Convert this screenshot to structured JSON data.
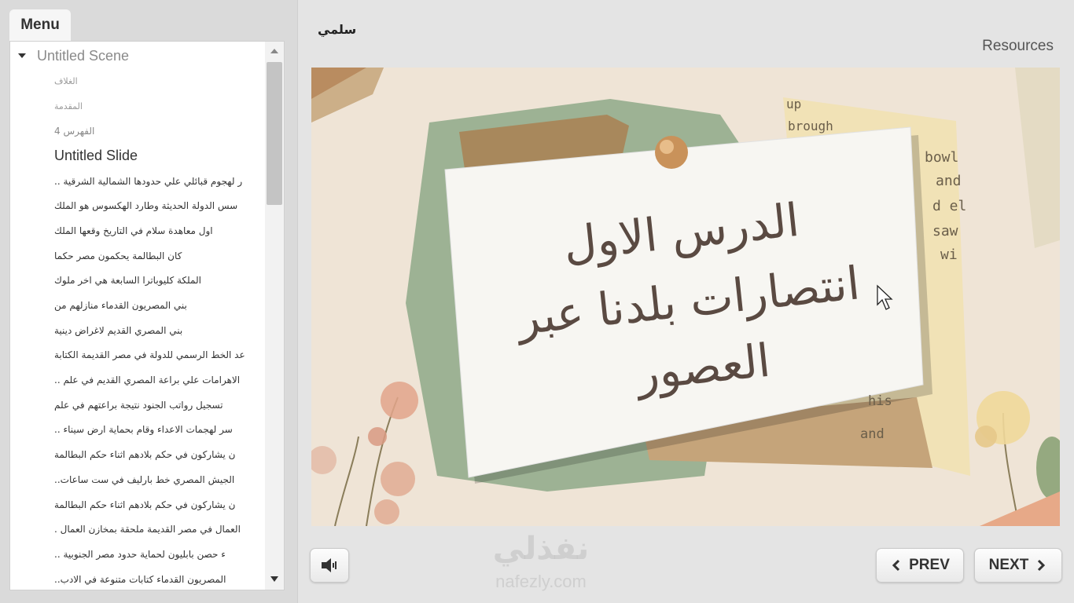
{
  "sidebar": {
    "tab_label": "Menu",
    "scene_label": "Untitled Scene",
    "items": [
      {
        "label": "الغلاف"
      },
      {
        "label": "المقدمة"
      },
      {
        "label": "الفهرس 4"
      },
      {
        "label": "Untitled Slide"
      },
      {
        "label": ".. ر لهجوم قبائلي علي حدودها الشمالية الشرقية"
      },
      {
        "label": "سس الدولة الحديثة وطارد الهكسوس هو الملك"
      },
      {
        "label": "اول معاهدة سلام في التاريخ وقعها الملك"
      },
      {
        "label": "كان البطالمة يحكمون مصر حكما"
      },
      {
        "label": "الملكة كليوباترا السابعة هي اخر ملوك"
      },
      {
        "label": "بني المصريون القدماء منازلهم من"
      },
      {
        "label": "بني المصري القديم لاغراض دينية"
      },
      {
        "label": "عد الخط الرسمي للدولة في مصر القديمة الكتابة"
      },
      {
        "label": ".. الاهرامات علي براعة المصري القديم في علم"
      },
      {
        "label": "تسجيل رواتب الجنود نتيجة براعتهم في علم"
      },
      {
        "label": ".. سر لهجمات الاعداء وقام بحماية ارض سيناء"
      },
      {
        "label": "ن يشاركون في حكم بلادهم اثناء حكم البطالمة"
      },
      {
        "label": "..الجيش المصري خط بارليف في ست ساعات"
      },
      {
        "label": "ن يشاركون في حكم بلادهم اثناء حكم البطالمة"
      },
      {
        "label": ". العمال في مصر القديمة ملحقة بمخازن العمال"
      },
      {
        "label": ".. ء حصن بابليون لحماية حدود مصر الجنوبية"
      },
      {
        "label": "..المصريون القدماء كتابات متنوعة في الادب"
      }
    ]
  },
  "header": {
    "course_title": "سلمي",
    "resources_label": "Resources"
  },
  "slide": {
    "title_line1": "الدرس الاول",
    "title_line2": "انتصارات بلدنا عبر",
    "title_line3": "العصور",
    "newsprint_words": [
      "up",
      "brough",
      "bowl",
      "and",
      "d el",
      "saw",
      "wi",
      "his",
      "and"
    ]
  },
  "controls": {
    "prev_label": "PREV",
    "next_label": "NEXT"
  },
  "watermark": {
    "logo_text": "نفذلي",
    "url_text": "nafezly.com"
  },
  "colors": {
    "background": "#e4e4e4",
    "sidebar_bg": "#dadada",
    "paper_bg": "#efe4d6",
    "pin": "#d9a46a",
    "ink": "#5a4a42"
  }
}
